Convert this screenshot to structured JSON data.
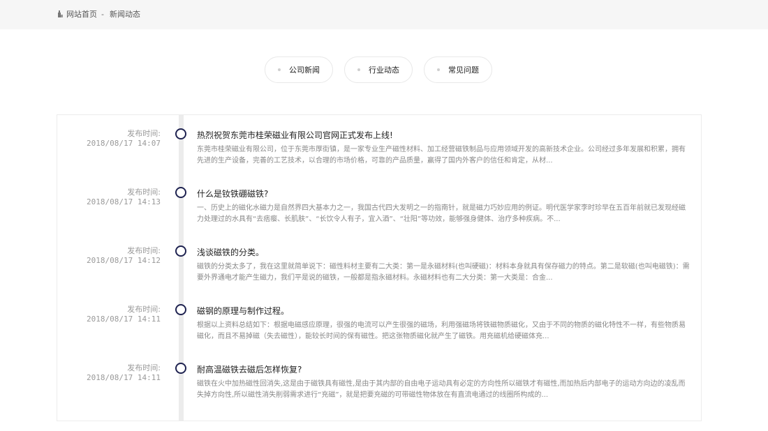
{
  "breadcrumb": {
    "home": "网站首页",
    "separator": "-",
    "current": "新闻动态"
  },
  "tabs": [
    {
      "label": "公司新闻"
    },
    {
      "label": "行业动态"
    },
    {
      "label": "常见问题"
    }
  ],
  "news": {
    "date_label": "发布时间:",
    "items": [
      {
        "date": "2018/08/17 14:07",
        "title": "热烈祝贺东莞市桂荣磁业有限公司官网正式发布上线!",
        "summary": "东莞市桂荣磁业有限公司，位于东莞市厚街镇，是一家专业生产磁性材料、加工经营磁铁制品与应用领域开发的高新技术企业。公司经过多年发展和积累，拥有先进的生产设备，完善的工艺技术，以合理的市场价格，可靠的产品质量，赢得了国内外客户的信任和肯定，从材..."
      },
      {
        "date": "2018/08/17 14:13",
        "title": "什么是钕铁硼磁铁?",
        "summary": "一、历史上的磁化水磁力是自然界四大基本力之一，我国古代四大发明之一的指南针，就是磁力巧妙应用的例证。明代医学家李时珍早在五百年前就已发现经磁力处理过的水具有“去痞瘿、长肌肤”、“长饮令人有子，宜入酒”、“壮阳”等功效，能够强身健体、治疗多种疾病。不..."
      },
      {
        "date": "2018/08/17 14:12",
        "title": "浅谈磁铁的分类。",
        "summary": "磁铁的分类太多了，我在这里就简单说下：磁性料材主要有二大类：第一是永磁材料(也叫硬磁)：材料本身就具有保存磁力的特点。第二是软磁(也叫电磁铁)：需要外界通电才能产生磁力，我们平是说的磁铁，一般都是指永磁材料。永磁材料也有二大分类：第一大类是：合金..."
      },
      {
        "date": "2018/08/17 14:11",
        "title": "磁钢的原理与制作过程。",
        "summary": "根据以上资料总结如下：根据电磁感应原理，很强的电流可以产生很强的磁场，利用强磁场将铁磁物质磁化，又由于不同的物质的磁化特性不一样，有些物质易磁化，而且不易掉磁（失去磁性），能较长时间的保有磁性。把这张物质磁化就产生了磁铁。用充磁机给硬磁体充..."
      },
      {
        "date": "2018/08/17 14:11",
        "title": "耐高温磁铁去磁后怎样恢复?",
        "summary": "磁铁在火中加热磁性回消失,这是由于磁铁具有磁性,是由于其内部的自由电子运动具有必定的方向性所以磁铁才有磁性,而加热后内部电子的运动方向边的凌乱而失掉方向性,所以磁性消失削弱需求进行“充磁”，就是把要充磁的可带磁性物体放在有直流电通过的线圈所构成的..."
      }
    ]
  }
}
